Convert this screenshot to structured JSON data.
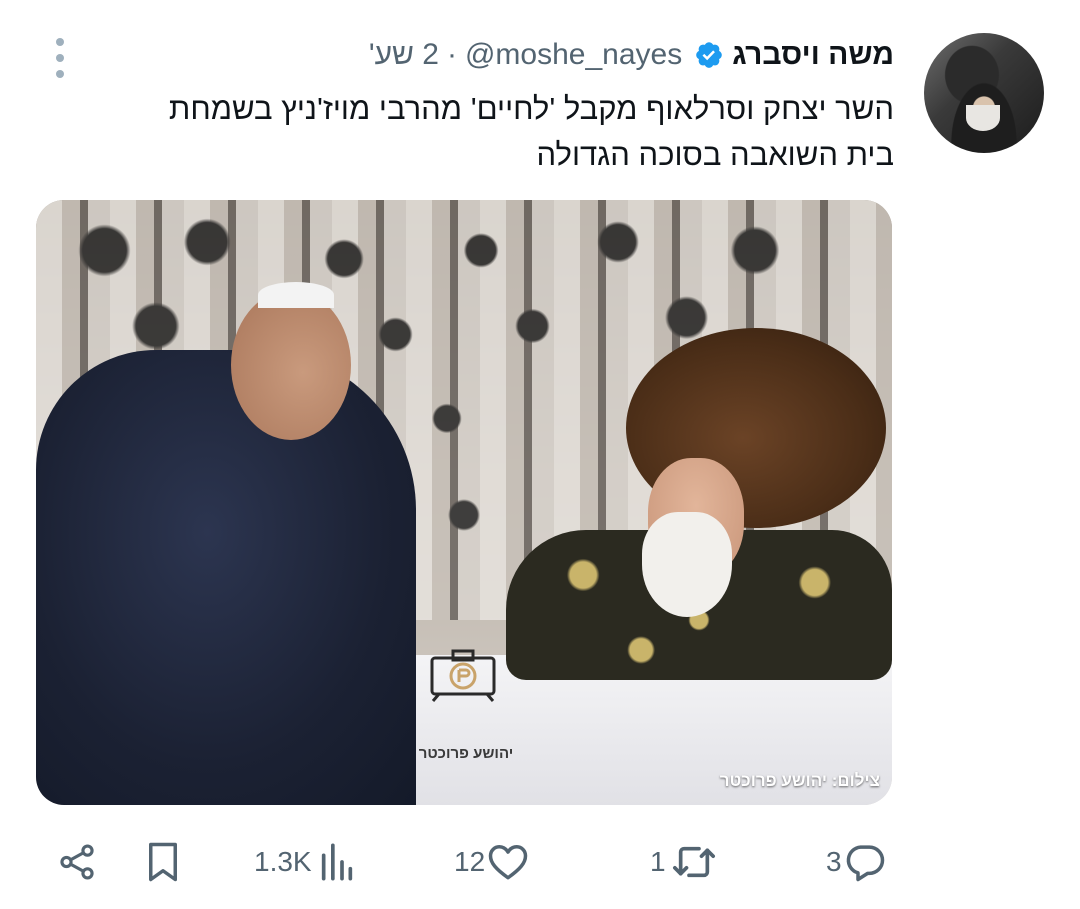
{
  "tweet": {
    "display_name": "משה ויסברג",
    "handle": "@moshe_nayes",
    "separator": "·",
    "time": "2 שע'",
    "text_lines": [
      "השר יצחק וסרלאוף  מקבל 'לחיים' מהרבי מויז'ניץ בשמחת",
      "בית השואבה בסוכה הגדולה"
    ]
  },
  "media": {
    "watermark_credit": "יהושע פרוכטר",
    "photo_credit": "צילום: יהושע פרוכטר"
  },
  "actions": {
    "views_count": "1.3K",
    "likes_count": "12",
    "reposts_count": "1",
    "replies_count": "3"
  },
  "icons": {
    "verified": "verified-badge-icon",
    "menu": "more-vertical-icon",
    "share": "share-icon",
    "bookmark": "bookmark-icon",
    "views": "views-chart-icon",
    "like": "heart-icon",
    "repost": "repost-icon",
    "reply": "reply-icon"
  },
  "colors": {
    "verified_blue": "#1d9bf0",
    "secondary_text": "#536471",
    "primary_text": "#0f1419"
  }
}
